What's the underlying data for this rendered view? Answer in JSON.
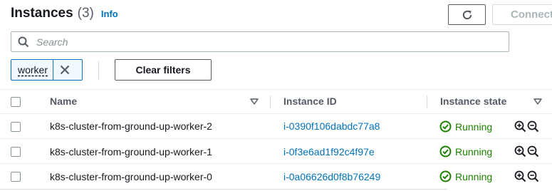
{
  "header": {
    "title": "Instances",
    "count": "(3)",
    "info_link": "Info",
    "connect_label": "Connect"
  },
  "search": {
    "placeholder": "Search"
  },
  "filter_token": {
    "label": "worker"
  },
  "clear_filters_label": "Clear filters",
  "table": {
    "columns": [
      {
        "label": "Name",
        "sortable": true
      },
      {
        "label": "Instance ID",
        "sortable": false
      },
      {
        "label": "Instance state",
        "sortable": true
      }
    ],
    "rows": [
      {
        "name": "k8s-cluster-from-ground-up-worker-2",
        "instance_id": "i-0390f106dabdc77a8",
        "state": "Running"
      },
      {
        "name": "k8s-cluster-from-ground-up-worker-1",
        "instance_id": "i-0f3e6ad1f92c4f97e",
        "state": "Running"
      },
      {
        "name": "k8s-cluster-from-ground-up-worker-0",
        "instance_id": "i-0a06626d0f8b76249",
        "state": "Running"
      }
    ]
  },
  "colors": {
    "link": "#0073bb",
    "running": "#1d8102",
    "border": "#545b64",
    "disabled": "#aab7b8"
  },
  "icons": [
    "refresh-icon",
    "search-icon",
    "close-icon",
    "sort-caret-icon",
    "status-check-icon",
    "zoom-in-icon",
    "zoom-out-icon"
  ]
}
